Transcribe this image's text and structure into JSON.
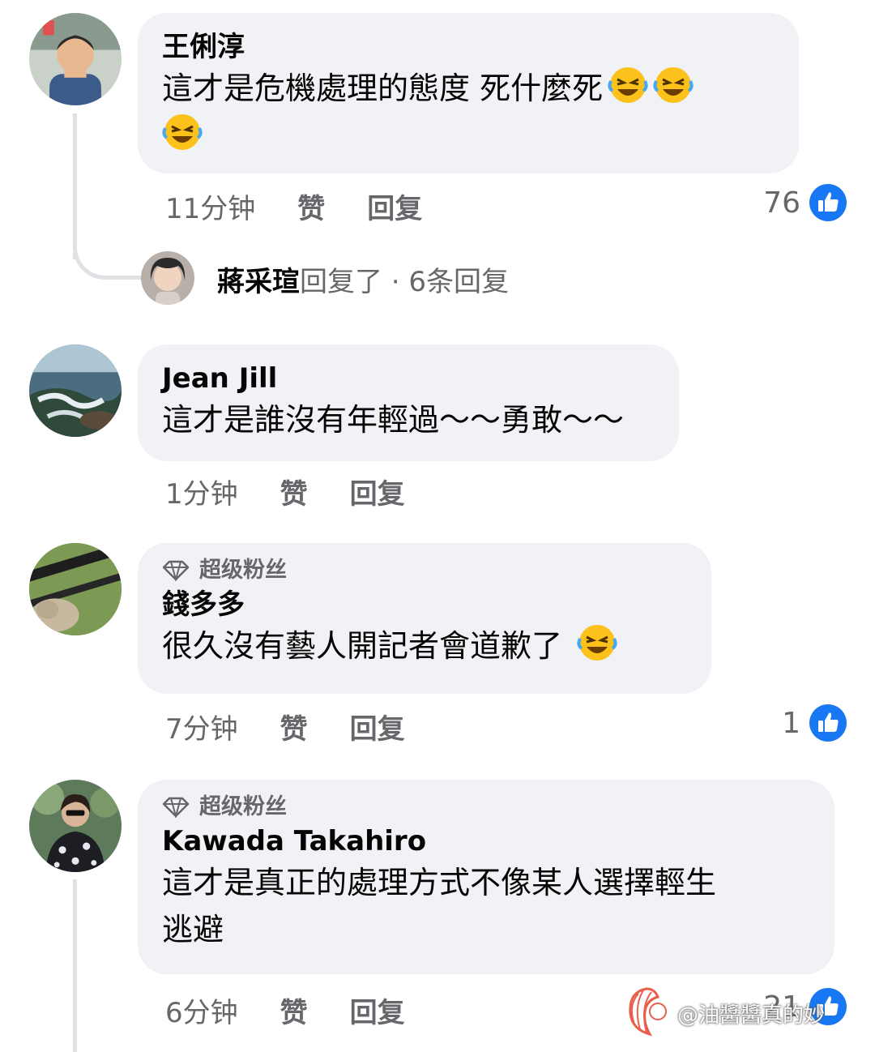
{
  "comments": [
    {
      "author": "王俐淳",
      "text": "這才是危機處理的態度 死什麼死",
      "text_line2": "",
      "emoji": [
        "rofl-emoji",
        "rofl-emoji",
        "rofl-emoji"
      ],
      "time": "11分钟",
      "like_label": "赞",
      "reply_label": "回复",
      "reaction_count": "76",
      "reply_summary": {
        "name": "蔣采瑄",
        "text": "回复了 · 6条回复"
      }
    },
    {
      "author": "Jean  Jill",
      "text": "這才是誰沒有年輕過～～勇敢～～",
      "time": "1分钟",
      "like_label": "赞",
      "reply_label": "回复"
    },
    {
      "badge": "超级粉丝",
      "author": "錢多多",
      "text": "很久沒有藝人開記者會道歉了",
      "emoji": [
        "rofl-emoji"
      ],
      "time": "7分钟",
      "like_label": "赞",
      "reply_label": "回复",
      "reaction_count": "1"
    },
    {
      "badge": "超级粉丝",
      "author": "Kawada Takahiro",
      "text": "這才是真正的處理方式不像某人選擇輕生",
      "text_line2": "逃避",
      "time": "6分钟",
      "like_label": "赞",
      "reply_label": "回复",
      "reaction_count": "21"
    }
  ],
  "watermark": "@油醬醬真的妙",
  "colors": {
    "bubble": "#f0f2f5",
    "like_blue": "#1877f2",
    "meta_gray": "#65676b"
  }
}
